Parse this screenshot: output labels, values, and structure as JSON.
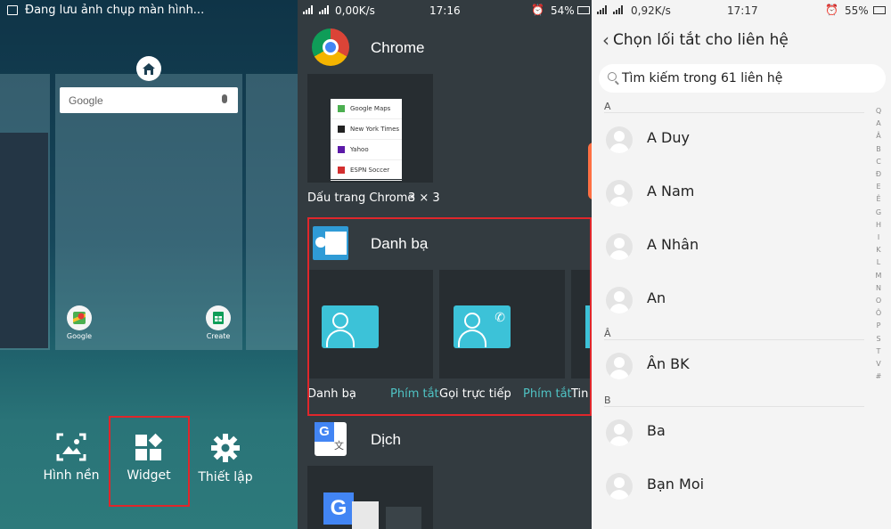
{
  "panel1": {
    "notification": "Đang lưu ảnh chụp màn hình...",
    "search_widget": {
      "logo": "Google",
      "icon": "mic-icon"
    },
    "home_screen_apps": [
      {
        "label": "Google",
        "icon": "google-maps-icon"
      },
      {
        "label": "Create",
        "icon": "sheets-create-icon"
      }
    ],
    "dock": [
      {
        "label": "Hình nền",
        "icon": "wallpaper-icon"
      },
      {
        "label": "Widget",
        "icon": "widget-icon"
      },
      {
        "label": "Thiết lập",
        "icon": "gear-icon"
      }
    ],
    "highlight_color": "#e0262b"
  },
  "panel2": {
    "status": {
      "speed": "0,00K/s",
      "time": "17:16",
      "battery": "54%"
    },
    "sections": [
      {
        "app": "Chrome",
        "widgets": [
          {
            "name": "Dấu trang Chrome",
            "size": "3 × 3",
            "bookmarks": [
              "Google Maps",
              "New York Times",
              "Yahoo",
              "ESPN Soccer"
            ]
          }
        ]
      },
      {
        "app": "Danh bạ",
        "widgets": [
          {
            "name": "Danh bạ",
            "tag": "Phím tắt"
          },
          {
            "name": "Gọi trực tiếp",
            "tag": "Phím tắt"
          },
          {
            "name": "Tin",
            "tag": ""
          }
        ]
      },
      {
        "app": "Dịch",
        "widgets": []
      }
    ]
  },
  "panel3": {
    "status": {
      "speed": "0,92K/s",
      "time": "17:17",
      "battery": "55%"
    },
    "title": "Chọn lối tắt cho liên hệ",
    "search_placeholder": "Tìm kiếm trong 61 liên hệ",
    "groups": [
      {
        "letter": "A",
        "contacts": [
          "A Duy",
          "A Nam",
          "A Nhân",
          "An"
        ]
      },
      {
        "letter": "Â",
        "contacts": [
          "Ân BK"
        ]
      },
      {
        "letter": "B",
        "contacts": [
          "Ba",
          "Bạn Moi"
        ]
      }
    ],
    "alphabet": [
      "Q",
      "A",
      "Â",
      "B",
      "C",
      "Đ",
      "E",
      "Ê",
      "G",
      "H",
      "I",
      "K",
      "L",
      "M",
      "N",
      "O",
      "Ô",
      "P",
      "S",
      "T",
      "V",
      "#"
    ]
  }
}
